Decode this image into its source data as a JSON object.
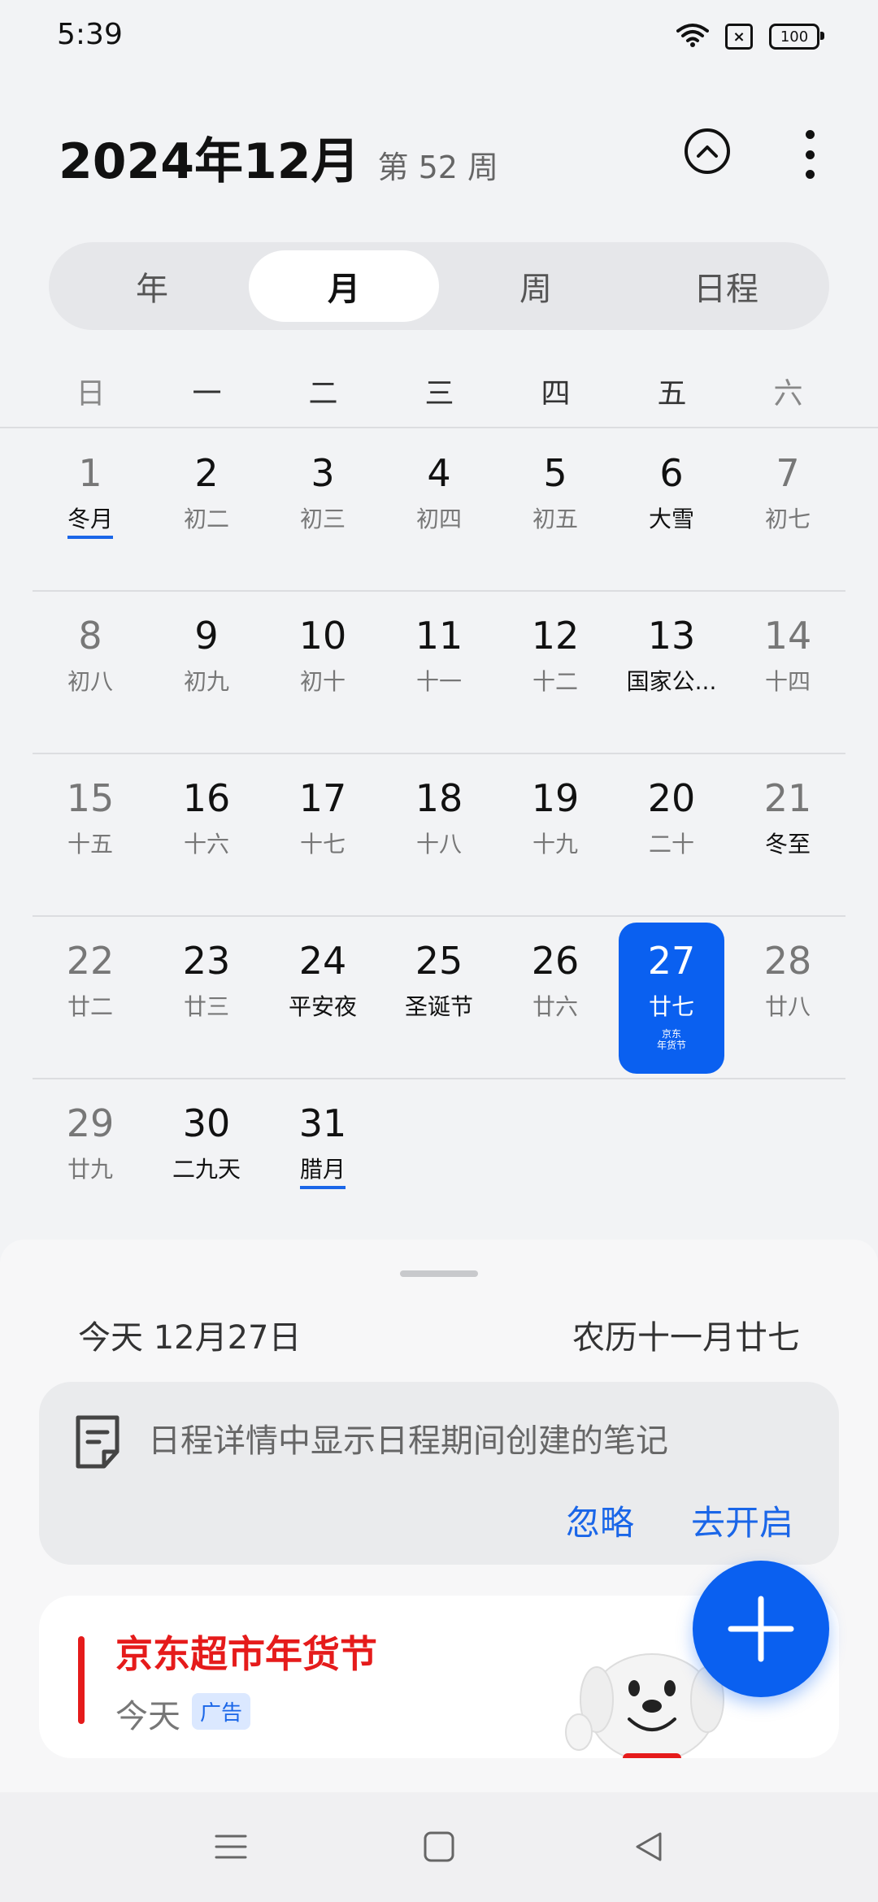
{
  "status": {
    "time": "5:39",
    "battery": "100"
  },
  "header": {
    "title": "2024年12月",
    "week": "第 52 周"
  },
  "view_tabs": [
    "年",
    "月",
    "周",
    "日程"
  ],
  "view_tabs_active": "月",
  "weekdays": [
    "日",
    "一",
    "二",
    "三",
    "四",
    "五",
    "六"
  ],
  "weeks": [
    [
      {
        "num": "1",
        "sub": "冬月"
      },
      {
        "num": "2",
        "sub": "初二"
      },
      {
        "num": "3",
        "sub": "初三"
      },
      {
        "num": "4",
        "sub": "初四"
      },
      {
        "num": "5",
        "sub": "初五"
      },
      {
        "num": "6",
        "sub": "大雪"
      },
      {
        "num": "7",
        "sub": "初七"
      }
    ],
    [
      {
        "num": "8",
        "sub": "初八"
      },
      {
        "num": "9",
        "sub": "初九"
      },
      {
        "num": "10",
        "sub": "初十"
      },
      {
        "num": "11",
        "sub": "十一"
      },
      {
        "num": "12",
        "sub": "十二"
      },
      {
        "num": "13",
        "sub": "国家公..."
      },
      {
        "num": "14",
        "sub": "十四"
      }
    ],
    [
      {
        "num": "15",
        "sub": "十五"
      },
      {
        "num": "16",
        "sub": "十六"
      },
      {
        "num": "17",
        "sub": "十七"
      },
      {
        "num": "18",
        "sub": "十八"
      },
      {
        "num": "19",
        "sub": "十九"
      },
      {
        "num": "20",
        "sub": "二十"
      },
      {
        "num": "21",
        "sub": "冬至"
      }
    ],
    [
      {
        "num": "22",
        "sub": "廿二"
      },
      {
        "num": "23",
        "sub": "廿三"
      },
      {
        "num": "24",
        "sub": "平安夜"
      },
      {
        "num": "25",
        "sub": "圣诞节"
      },
      {
        "num": "26",
        "sub": "廿六"
      },
      {
        "num": "27",
        "sub": "廿七"
      },
      {
        "num": "28",
        "sub": "廿八"
      }
    ],
    [
      {
        "num": "29",
        "sub": "廿九"
      },
      {
        "num": "30",
        "sub": "二九天"
      },
      {
        "num": "31",
        "sub": "腊月"
      }
    ]
  ],
  "selected_day_badge": [
    "京东",
    "年货节"
  ],
  "sheet": {
    "today": "今天  12月27日",
    "lunar": "农历十一月廿七",
    "notice_text": "日程详情中显示日程期间创建的笔记",
    "ignore": "忽略",
    "enable": "去开启"
  },
  "ad": {
    "title": "京东超市年货节",
    "day": "今天",
    "badge": "广告"
  },
  "colors": {
    "accent": "#0a60f0",
    "ad_red": "#e51b1b",
    "background": "#f2f3f5"
  }
}
